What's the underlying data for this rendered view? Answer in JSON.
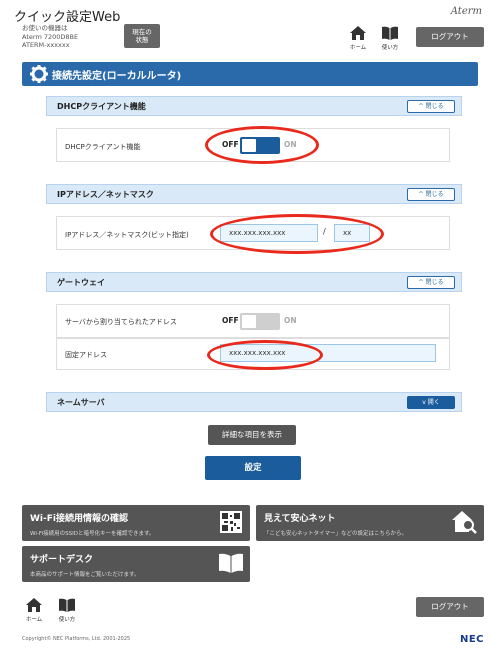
{
  "header": {
    "app_title": "クイック設定Web",
    "device_line1": "お使いの機器は",
    "device_line2": "Aterm 7200D8BE",
    "device_line3": "ATERM-xxxxxx",
    "status_line1": "現在の",
    "status_line2": "状態",
    "brand": "Aterm",
    "home_label": "ホーム",
    "guide_label": "使い方",
    "logout_label": "ログアウト"
  },
  "page": {
    "title": "接続先設定(ローカルルータ)"
  },
  "sections": {
    "dhcp": {
      "title": "DHCPクライアント機能",
      "collapse_label": "閉じる",
      "row_label": "DHCPクライアント機能",
      "toggle_off": "OFF",
      "toggle_on": "ON",
      "toggle_state": "off"
    },
    "ip": {
      "title": "IPアドレス／ネットマスク",
      "collapse_label": "閉じる",
      "row_label": "IPアドレス／ネットマスク(ビット指定)",
      "ip_value": "xxx.xxx.xxx.xxx",
      "separator": "/",
      "mask_value": "xx"
    },
    "gateway": {
      "title": "ゲートウェイ",
      "collapse_label": "閉じる",
      "row1_label": "サーバから割り当てられたアドレス",
      "toggle_off": "OFF",
      "toggle_on": "ON",
      "toggle_state": "off-disabled",
      "row2_label": "固定アドレス",
      "fixed_value": "xxx.xxx.xxx.xxx"
    },
    "nameserver": {
      "title": "ネームサーバ",
      "expand_label": "開く"
    }
  },
  "actions": {
    "detail_label": "詳細な項目を表示",
    "apply_label": "設定"
  },
  "tiles": {
    "wifi": {
      "title": "Wi-Fi接続用情報の確認",
      "desc": "Wi-Fi接続用のSSIDと暗号化キーを確認できます。"
    },
    "safety": {
      "title": "見えて安心ネット",
      "desc": "「こども安心ネットタイマー」などの設定はこちらから。"
    },
    "support": {
      "title": "サポートデスク",
      "desc": "本商品のサポート情報をご覧いただけます。"
    }
  },
  "footer": {
    "home_label": "ホーム",
    "guide_label": "使い方",
    "logout_label": "ログアウト",
    "copyright": "Copyright© NEC Platforms, Ltd. 2001-2025",
    "nec_logo": "NEC"
  },
  "colors": {
    "primary": "#2a6aaa",
    "section_bg": "#d9e9f7",
    "highlight": "#e8291c",
    "dark_button": "#555555"
  }
}
